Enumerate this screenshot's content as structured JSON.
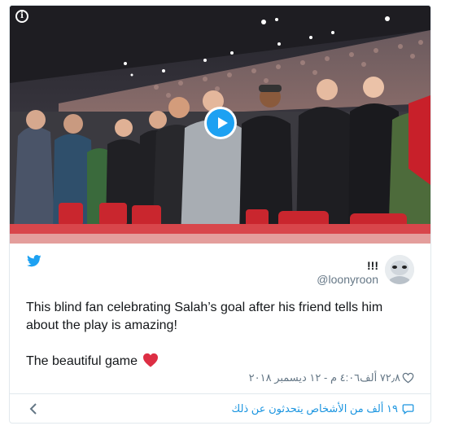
{
  "tweet": {
    "display_name": "!!!",
    "handle": "@loonyroon",
    "text_line1": "This blind fan celebrating Salah’s goal  after his friend tells him about the play is amazing!",
    "text_line2": "The beautiful game",
    "likes": "٧٢٫٨ ألف",
    "timestamp": "٤:٠٦ م - ١٢ ديسمبر ٢٠١٨",
    "conversation": "١٩ ألف من الأشخاص يتحدثون عن ذلك"
  },
  "icons": {
    "info": "info-icon",
    "play": "play-icon",
    "bird": "twitter-bird-icon",
    "heart_emoji": "red-heart-emoji",
    "like": "heart-outline-icon",
    "reply": "speech-bubble-icon",
    "back": "chevron-left-icon"
  },
  "colors": {
    "brand": "#1da1f2",
    "link": "#1b95e0",
    "heart": "#e0245e",
    "text": "#14171a",
    "muted": "#657786",
    "border": "#e1e8ed"
  }
}
